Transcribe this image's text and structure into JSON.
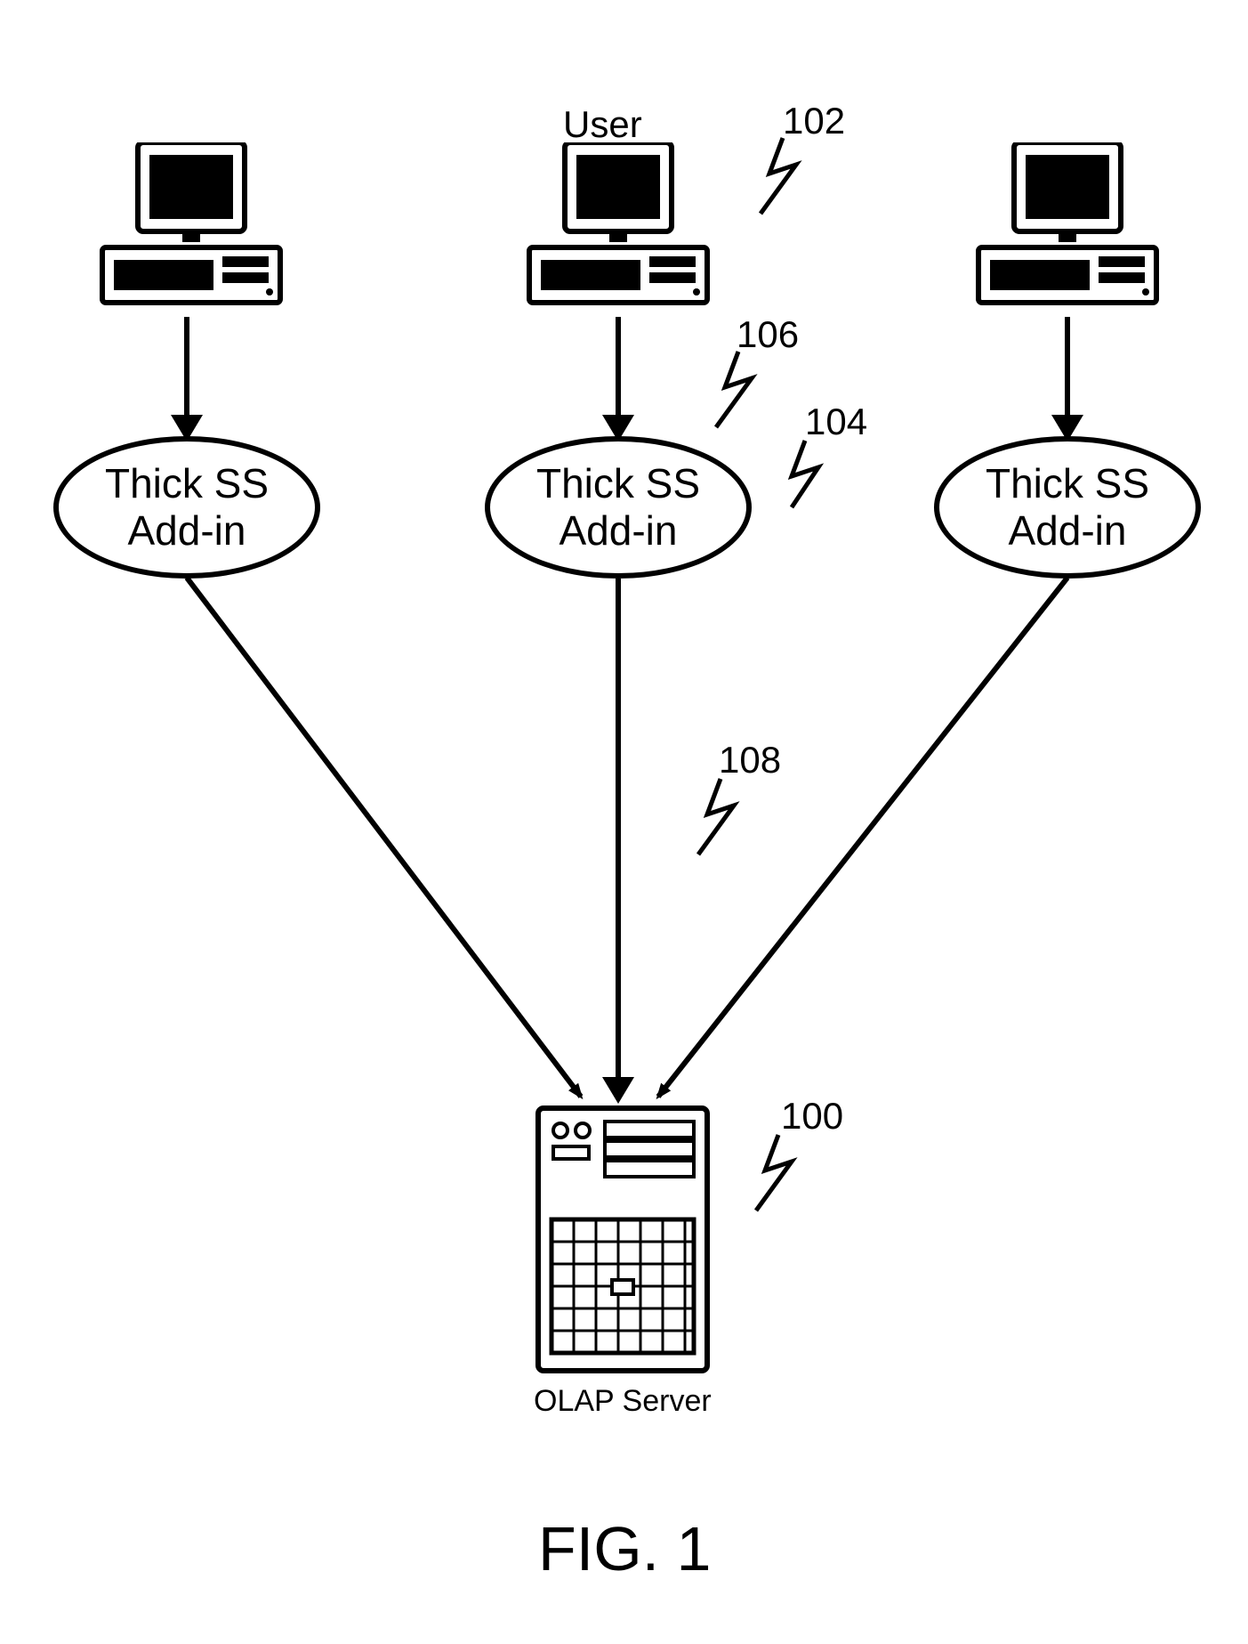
{
  "figure_caption": "FIG. 1",
  "user_label": "User",
  "olap_label": "OLAP Server",
  "references": {
    "user_ref": "102",
    "addin_ref": "104",
    "conn1_ref": "106",
    "conn2_ref": "108",
    "server_ref": "100"
  },
  "nodes": {
    "addin_left": {
      "line1": "Thick SS",
      "line2": "Add-in"
    },
    "addin_mid": {
      "line1": "Thick SS",
      "line2": "Add-in"
    },
    "addin_right": {
      "line1": "Thick SS",
      "line2": "Add-in"
    }
  }
}
